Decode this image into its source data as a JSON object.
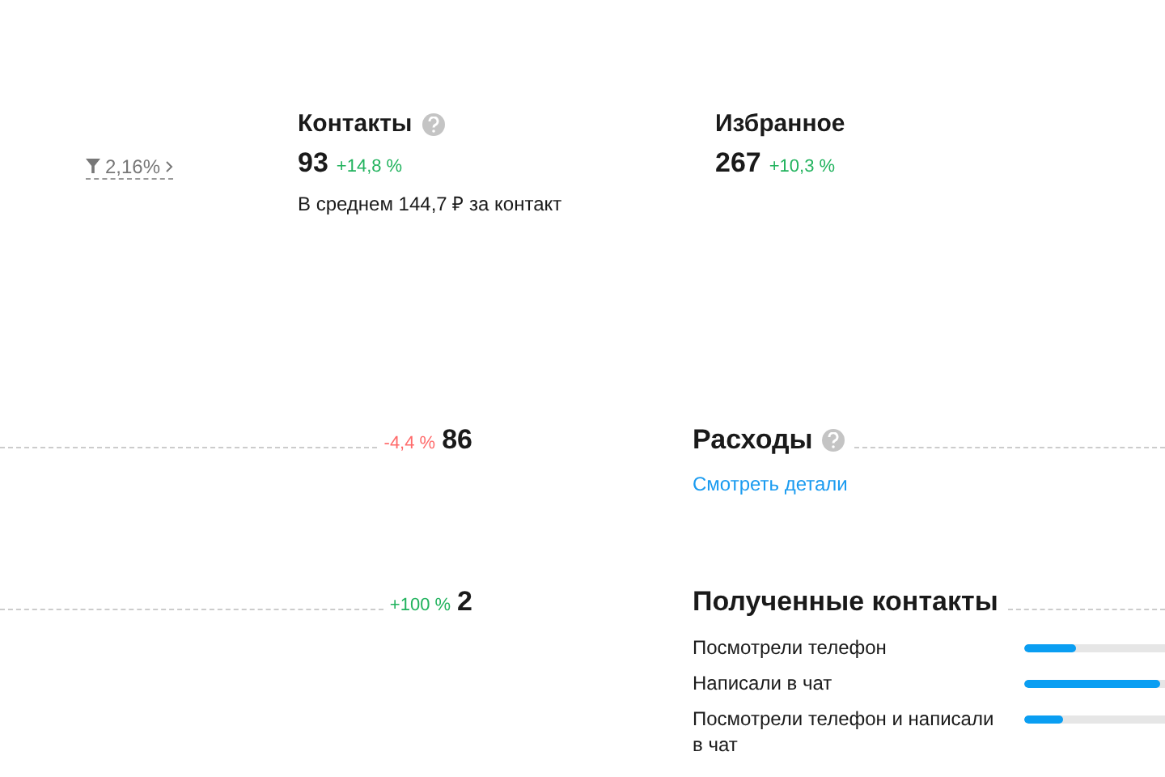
{
  "conversion": {
    "value": "2,16%"
  },
  "metrics": [
    {
      "title": "Контакты",
      "help": true,
      "value": "93",
      "change": "+14,8 %",
      "color": "#22b35e",
      "note": "В среднем 144,7 ₽ за контакт"
    },
    {
      "title": "Избранное",
      "value": "267",
      "change": "+10,3 %",
      "color": "#22b35e"
    }
  ],
  "rows": [
    {
      "change": "-4,4 %",
      "color": "#ff6b6b",
      "value": "86"
    },
    {
      "change": "+100 %",
      "color": "#22b35e",
      "value": "2"
    }
  ],
  "expenses": {
    "title": "Расходы",
    "help": true,
    "link": "Смотреть детали"
  },
  "received_contacts": {
    "title": "Полученные контакты",
    "items": [
      {
        "label": "Посмотрели телефон",
        "level": 0.37
      },
      {
        "label": "Написали в чат",
        "level": 0.97
      },
      {
        "label": "Посмотрели телефон и написали в чат",
        "level": 0.28
      }
    ]
  }
}
